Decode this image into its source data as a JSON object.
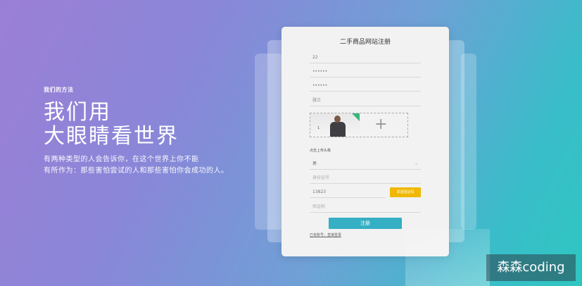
{
  "hero": {
    "eyebrow": "我们的方法",
    "headline_line1": "我们用",
    "headline_line2": "大眼睛看世界",
    "desc_line1": "有两种类型的人会告诉你，在这个世界上你不能",
    "desc_line2": "有所作为：那些害怕尝试的人和那些害怕你会成功的人。"
  },
  "form": {
    "title": "二手商品网站注册",
    "username_value": "22",
    "password_value": "••••••",
    "confirm_password_value": "••••••",
    "name_value": "张三",
    "image_number": "1",
    "upload_label": "点击上传头像",
    "gender_value": "男",
    "id_card_placeholder": "身份证号",
    "phone_value": "13823",
    "verify_button": "发送验证码",
    "code_placeholder": "验证码",
    "submit_label": "注册",
    "login_link": "已有账号，直接登录"
  },
  "watermark": "森森coding"
}
